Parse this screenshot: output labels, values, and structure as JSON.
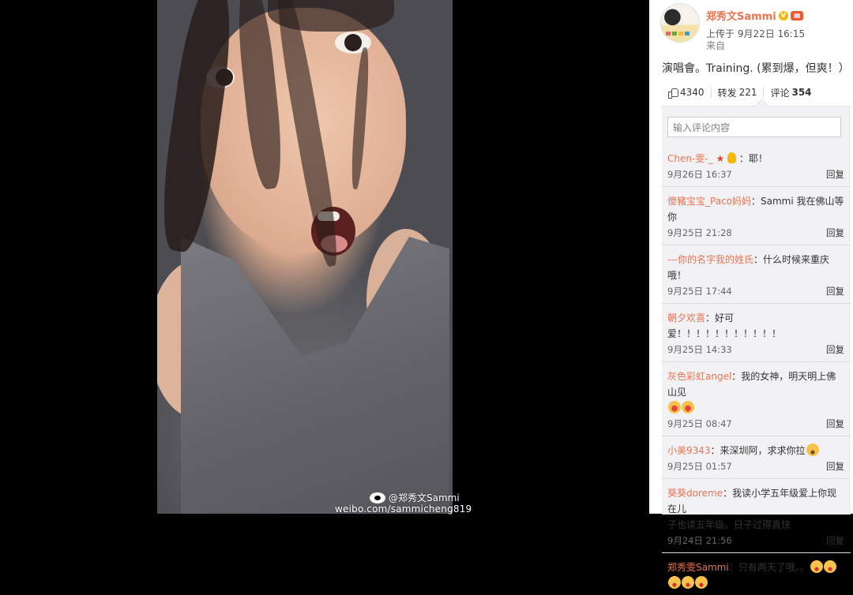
{
  "photo": {
    "watermark_name": "@郑秀文Sammi",
    "watermark_url": "weibo.com/sammicheng819"
  },
  "post": {
    "author": "郑秀文Sammi",
    "upload_time": "上传于 9月22日 16:15",
    "source": "来自",
    "text": "演唱會。Training. (累到爆，但爽！）"
  },
  "actions": {
    "likes": "4340",
    "repost_label": "转发",
    "repost_count": "221",
    "comment_label": "评论",
    "comment_count": "354"
  },
  "comment_input": {
    "placeholder": "输入评论内容"
  },
  "reply_label": "回复",
  "comments": [
    {
      "name": "Chen-雯-_",
      "text": "：耶！",
      "time": "9月26日 16:37"
    },
    {
      "name": "傻豬宝宝_Paco妈妈",
      "text": "：Sammi 我在佛山等你",
      "time": "9月25日 21:28"
    },
    {
      "name": "---你的名字我的姓氏",
      "text": "：什么时候来重庆哦！",
      "time": "9月25日 17:44"
    },
    {
      "name": "朝夕欢喜",
      "text": "：好可",
      "text2": "爱！！！！！！！！！！！",
      "time": "9月25日 14:33"
    },
    {
      "name": "灰色彩虹angel",
      "text": "：我的女神，明天明上佛山见",
      "time": "9月25日 08:47"
    },
    {
      "name": "小美9343",
      "text": "：来深圳阿，求求你拉",
      "time": "9月25日 01:57"
    },
    {
      "name": "葵葵doreme",
      "text": "：我读小学五年级爱上你现在儿",
      "text2": "子也读五年级。日子过得真快",
      "time": "9月24日 21:56"
    },
    {
      "name": "郑秀雯Sammi",
      "text": "：只有两天了哦。。",
      "time": ""
    }
  ]
}
